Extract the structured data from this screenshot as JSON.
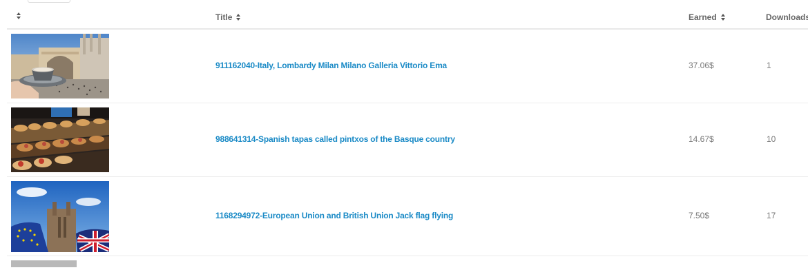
{
  "header": {
    "thumb_label": "",
    "title_label": "Title",
    "earned_label": "Earned",
    "downloads_label": "Downloads"
  },
  "rows": [
    {
      "title": "911162040-Italy, Lombardy Milan Milano Galleria Vittorio Ema",
      "earned": "37.06$",
      "downloads": "1",
      "thumbnail": "photo-milan-galleria-coffee"
    },
    {
      "title": "988641314-Spanish tapas called pintxos of the Basque country",
      "earned": "14.67$",
      "downloads": "10",
      "thumbnail": "photo-pintxos-tapas"
    },
    {
      "title": "1168294972-European Union and British Union Jack flag flying",
      "earned": "7.50$",
      "downloads": "17",
      "thumbnail": "photo-eu-uk-flags-parliament"
    }
  ],
  "colors": {
    "link": "#1a8ac6",
    "text": "#777777",
    "border": "#ececec"
  }
}
